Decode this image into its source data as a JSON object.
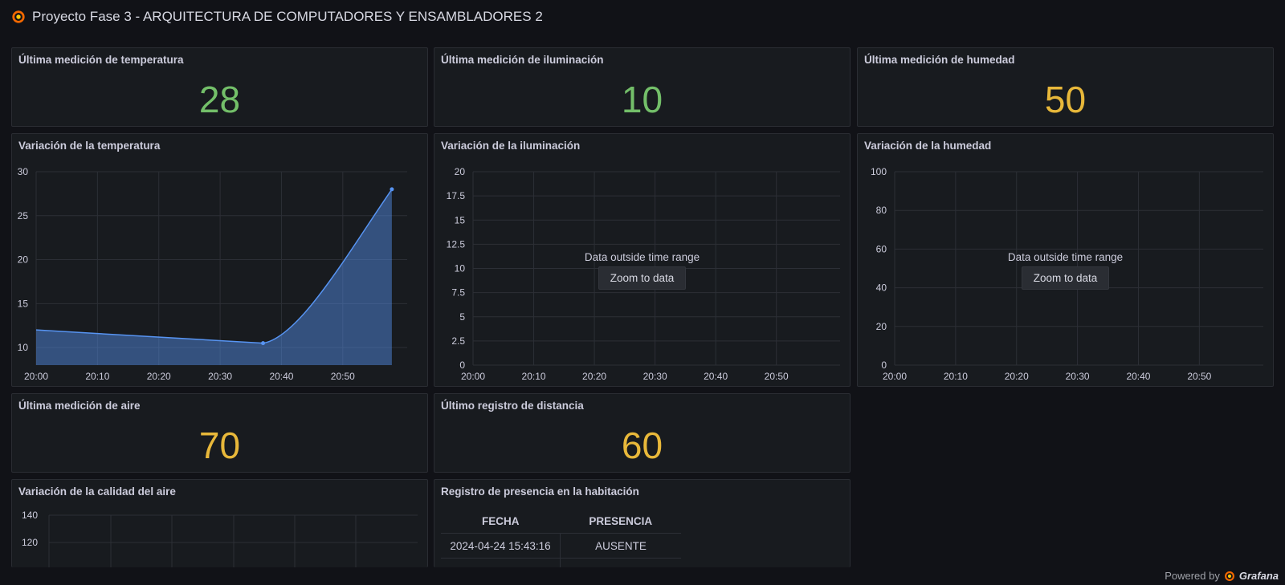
{
  "dashboard": {
    "title": "Proyecto Fase 3 - ARQUITECTURA DE COMPUTADORES Y ENSAMBLADORES 2"
  },
  "panels": {
    "temp_stat": {
      "title": "Última medición de temperatura",
      "value": "28"
    },
    "light_stat": {
      "title": "Última medición de iluminación",
      "value": "10"
    },
    "hum_stat": {
      "title": "Última medición de humedad",
      "value": "50"
    },
    "temp_chart": {
      "title": "Variación de la temperatura"
    },
    "light_chart": {
      "title": "Variación de la iluminación",
      "nodata": "Data outside time range",
      "zoom_label": "Zoom to data"
    },
    "hum_chart": {
      "title": "Variación de la humedad",
      "nodata": "Data outside time range",
      "zoom_label": "Zoom to data"
    },
    "air_stat": {
      "title": "Última medición de aire",
      "value": "70"
    },
    "dist_stat": {
      "title": "Último registro de distancia",
      "value": "60"
    },
    "air_chart": {
      "title": "Variación de la calidad del aire"
    },
    "presence_table": {
      "title": "Registro de presencia en la habitación",
      "columns": [
        "FECHA",
        "PRESENCIA"
      ],
      "rows": [
        [
          "2024-04-24 15:43:16",
          "AUSENTE"
        ]
      ]
    }
  },
  "footer": {
    "powered_by": "Powered by",
    "brand": "Grafana"
  },
  "colors": {
    "green": "#73bf69",
    "yellow": "#e8b83a",
    "series_blue": "#5794f2",
    "bg": "#111217",
    "panel": "#181b1f"
  },
  "chart_data": [
    {
      "type": "area",
      "title": "Variación de la temperatura",
      "x": [
        "20:00",
        "20:37",
        "20:39",
        "20:58"
      ],
      "series": [
        {
          "values": [
            12,
            10.5,
            10.7,
            28
          ]
        }
      ],
      "xticks": [
        "20:00",
        "20:10",
        "20:20",
        "20:30",
        "20:40",
        "20:50"
      ],
      "yticks": [
        10,
        15,
        20,
        25,
        30
      ],
      "ylim": [
        8,
        30
      ]
    },
    {
      "type": "line",
      "title": "Variación de la iluminación",
      "series": [],
      "xticks": [
        "20:00",
        "20:10",
        "20:20",
        "20:30",
        "20:40",
        "20:50"
      ],
      "yticks": [
        "0",
        "2.5",
        "5",
        "7.5",
        "10",
        "12.5",
        "15",
        "17.5",
        "20"
      ],
      "ylim": [
        0,
        20
      ]
    },
    {
      "type": "line",
      "title": "Variación de la humedad",
      "series": [],
      "xticks": [
        "20:00",
        "20:10",
        "20:20",
        "20:30",
        "20:40",
        "20:50"
      ],
      "yticks": [
        "0",
        "20",
        "40",
        "60",
        "80",
        "100"
      ],
      "ylim": [
        0,
        100
      ]
    },
    {
      "type": "line",
      "title": "Variación de la calidad del aire",
      "series": [],
      "yticks": [
        "120",
        "140"
      ]
    }
  ]
}
